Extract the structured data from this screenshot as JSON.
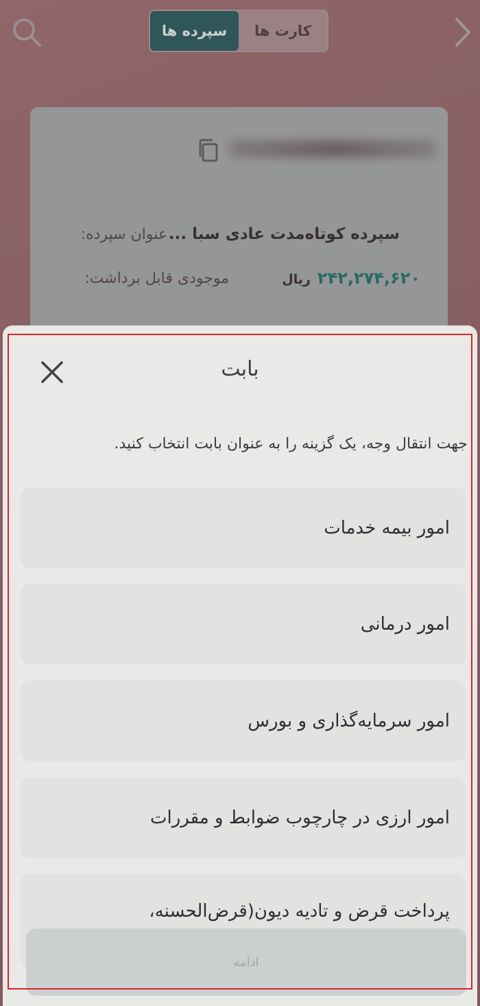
{
  "background_app": {
    "tabs": [
      {
        "label": "کارت ها",
        "active": false
      },
      {
        "label": "سپرده ها",
        "active": true
      }
    ],
    "card": {
      "title_label": "عنوان سپرده:",
      "title_value": "سپرده کوتاه‌مدت عادی سبا ...",
      "balance_label": "موجودی قابل برداشت:",
      "balance_value": "۲۴۲,۲۷۴,۶۲۰",
      "balance_unit": "ریال"
    }
  },
  "sheet": {
    "title": "بابت",
    "instruction": "جهت انتقال وجه، یک گزینه را به عنوان بابت انتخاب کنید.",
    "options": [
      {
        "label": "امور بیمه خدمات"
      },
      {
        "label": "امور درمانی"
      },
      {
        "label": "امور سرمایه‌گذاری و بورس"
      },
      {
        "label": "امور ارزی در چارچوب ضوابط و مقررات"
      },
      {
        "label": "پرداخت قرض و تادیه دیون(قرض‌الحسنه،"
      }
    ],
    "continue_label": "ادامه"
  },
  "colors": {
    "accent": "#235659",
    "amount": "#1e6b66",
    "sheet_bg": "#e9eae8",
    "option_bg": "#e2e3e1",
    "highlight_frame": "#d2262b"
  }
}
